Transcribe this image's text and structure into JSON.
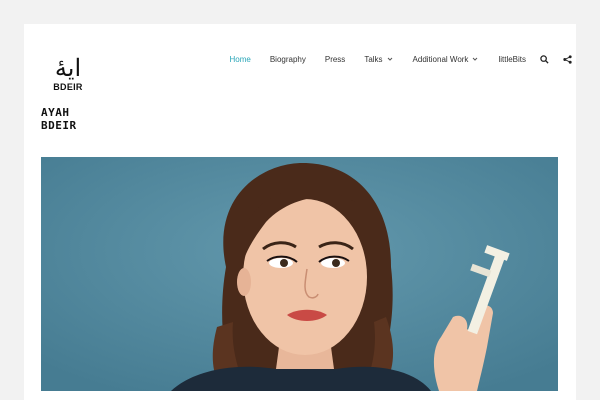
{
  "logo": {
    "glyph": "ايهٔ",
    "subtitle": "BDEIR"
  },
  "site_title": {
    "line1": "AYAH",
    "line2": "BDEIR"
  },
  "nav": {
    "items": [
      {
        "label": "Home",
        "active": true,
        "dropdown": false
      },
      {
        "label": "Biography",
        "active": false,
        "dropdown": false
      },
      {
        "label": "Press",
        "active": false,
        "dropdown": false
      },
      {
        "label": "Talks",
        "active": false,
        "dropdown": true
      },
      {
        "label": "Additional Work",
        "active": false,
        "dropdown": true
      },
      {
        "label": "littleBits",
        "active": false,
        "dropdown": false
      }
    ],
    "icons": [
      "search-icon",
      "share-icon"
    ]
  },
  "colors": {
    "accent": "#2aa6b8",
    "hero_bg": "#568aa0",
    "page_bg": "#f2f2f2"
  },
  "hero": {
    "image": "portrait-photo"
  }
}
